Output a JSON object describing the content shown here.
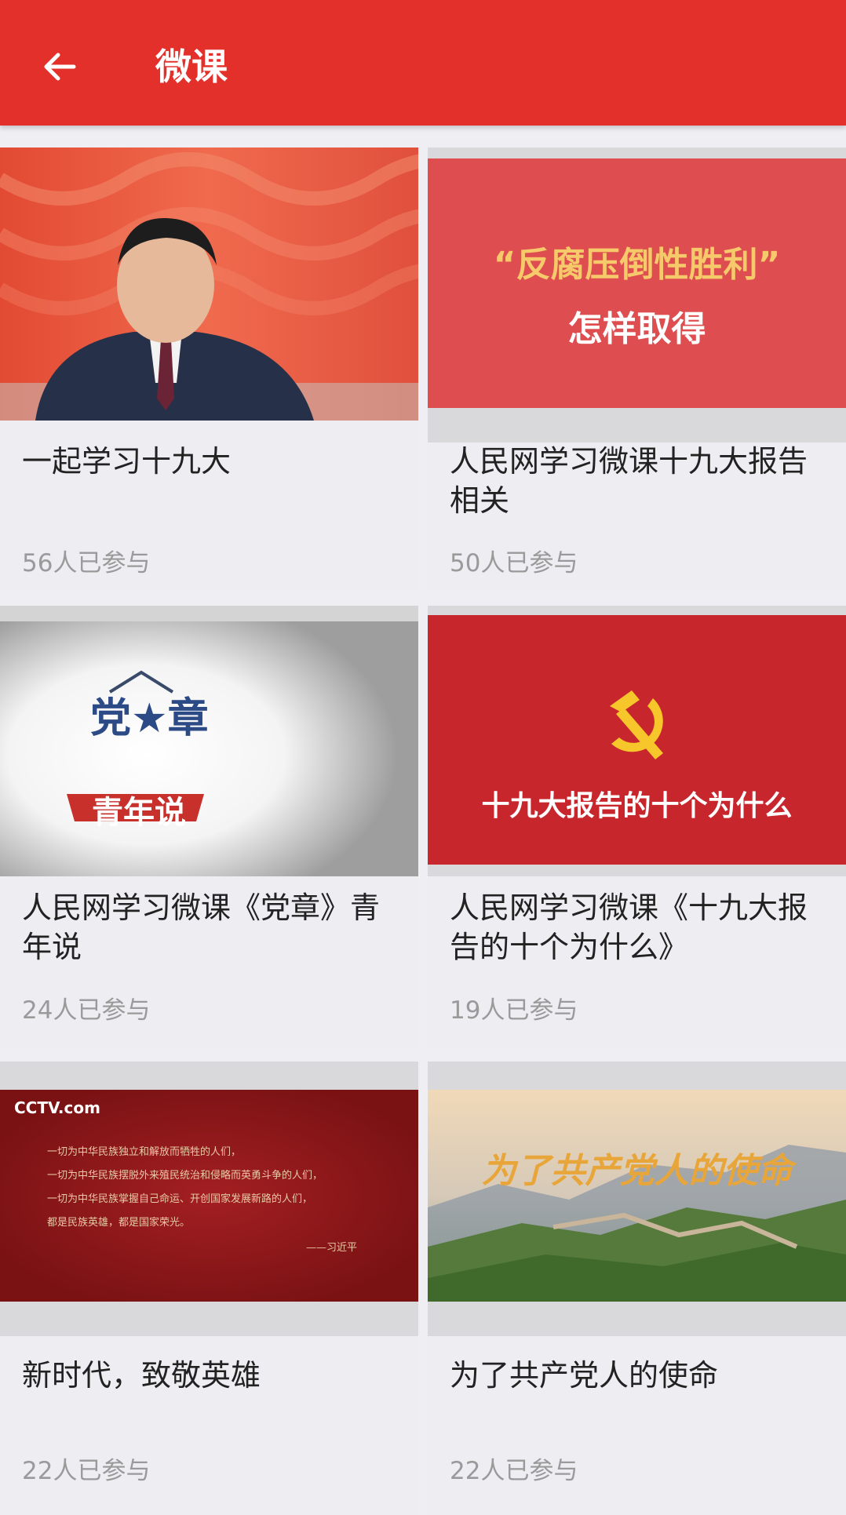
{
  "header": {
    "title": "微课",
    "back_icon": "arrow-left-icon",
    "background_color": "#e4302b"
  },
  "courses": [
    {
      "title": "一起学习十九大",
      "participants": "56人已参与",
      "thumbnail": "speaker-at-podium"
    },
    {
      "title": "人民网学习微课十九大报告相关",
      "participants": "50人已参与",
      "thumbnail": "text-banner",
      "thumb_line1": "“反腐压倒性胜利”",
      "thumb_line2": "怎样取得"
    },
    {
      "title": "人民网学习微课《党章》青年说",
      "participants": "24人已参与",
      "thumbnail": "logo-spotlight",
      "thumb_logo_top": "党★章",
      "thumb_logo_ribbon": "青年说"
    },
    {
      "title": "人民网学习微课《十九大报告的十个为什么》",
      "participants": "19人已参与",
      "thumbnail": "hammer-sickle-banner",
      "thumb_caption": "十九大报告的十个为什么"
    },
    {
      "title": "新时代，致敬英雄",
      "participants": "22人已参与",
      "thumbnail": "calligraphy-quote",
      "thumb_logo": "CCTV.com",
      "thumb_quote_lines": [
        "一切为中华民族独立和解放而牺牲的人们，",
        "一切为中华民族摆脱外来殖民统治和侵略而英勇斗争的人们，",
        "一切为中华民族掌握自己命运、开创国家发展新路的人们，",
        "都是民族英雄，都是国家荣光。"
      ],
      "thumb_signature": "——习近平"
    },
    {
      "title": "为了共产党人的使命",
      "participants": "22人已参与",
      "thumbnail": "great-wall-title",
      "thumb_title": "为了共产党人的使命"
    }
  ]
}
